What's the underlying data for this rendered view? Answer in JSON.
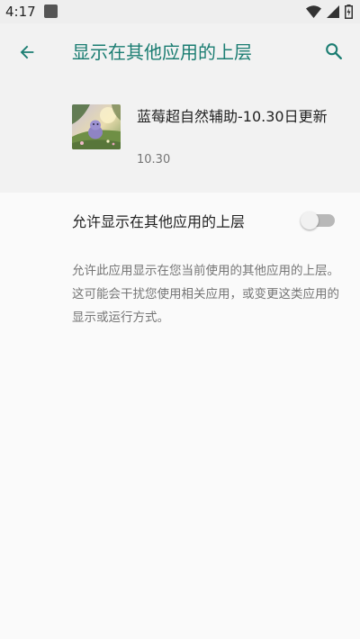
{
  "status_bar": {
    "time": "4:17",
    "icons": [
      "notification-icon",
      "wifi-icon",
      "signal-icon",
      "battery-icon"
    ]
  },
  "app_bar": {
    "title": "显示在其他应用的上层",
    "back_icon": "arrow-back-icon",
    "search_icon": "search-icon"
  },
  "app_info": {
    "name": "蓝莓超自然辅助-10.30日更新",
    "version": "10.30"
  },
  "permission": {
    "label": "允许显示在其他应用的上层",
    "enabled": false
  },
  "description": "允许此应用显示在您当前使用的其他应用的上层。这可能会干扰您使用相关应用，或变更这类应用的显示或运行方式。",
  "colors": {
    "accent": "#1b7d72",
    "header_bg": "#f2f2f2",
    "body_bg": "#fafafa",
    "secondary_text": "#757575",
    "switch_off_track": "#b8b8b8",
    "switch_off_thumb": "#f1f1f1"
  }
}
